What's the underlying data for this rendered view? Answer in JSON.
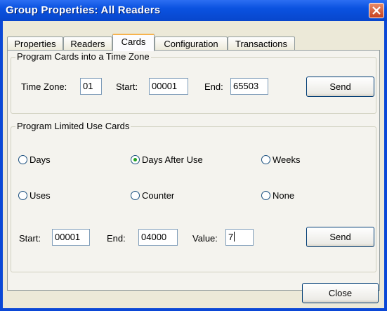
{
  "window": {
    "title": "Group Properties: All Readers"
  },
  "tabs": [
    {
      "label": "Properties"
    },
    {
      "label": "Readers"
    },
    {
      "label": "Cards"
    },
    {
      "label": "Configuration"
    },
    {
      "label": "Transactions"
    }
  ],
  "active_tab": "Cards",
  "time_zone_group": {
    "legend": "Program Cards into a Time Zone",
    "time_zone_label": "Time Zone:",
    "time_zone_value": "01",
    "start_label": "Start:",
    "start_value": "00001",
    "end_label": "End:",
    "end_value": "65503",
    "send_label": "Send"
  },
  "limited_use_group": {
    "legend": "Program Limited Use Cards",
    "options": [
      {
        "label": "Days",
        "selected": false
      },
      {
        "label": "Days After Use",
        "selected": true
      },
      {
        "label": "Weeks",
        "selected": false
      },
      {
        "label": "Uses",
        "selected": false
      },
      {
        "label": "Counter",
        "selected": false
      },
      {
        "label": "None",
        "selected": false
      }
    ],
    "start_label": "Start:",
    "start_value": "00001",
    "end_label": "End:",
    "end_value": "04000",
    "value_label": "Value:",
    "value_value": "7",
    "send_label": "Send"
  },
  "close_label": "Close",
  "colors": {
    "title_bar": "#0a52e0",
    "dialog_bg": "#ece9d8",
    "radio_selected": "#21a121",
    "active_tab_highlight": "#f7b34d"
  }
}
